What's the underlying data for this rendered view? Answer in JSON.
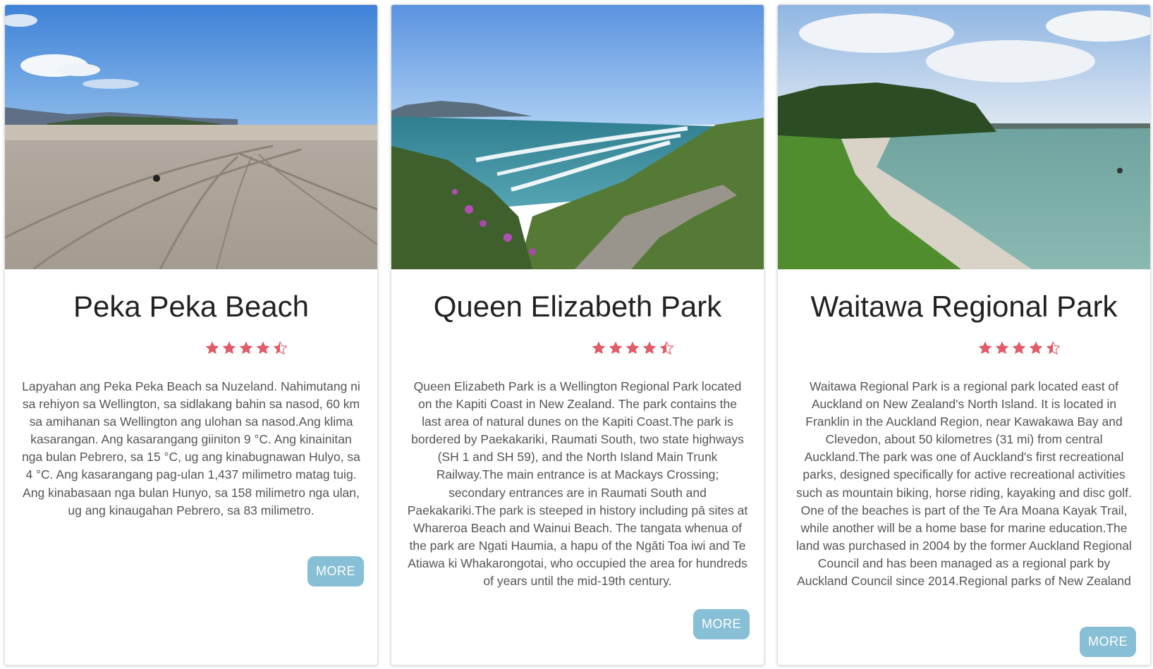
{
  "colors": {
    "star": "#e05c68",
    "more_button": "#87bfd6",
    "title": "#222222",
    "description": "#555555"
  },
  "cards": [
    {
      "title": "Peka Peka Beach",
      "rating": 4.5,
      "description": "Lapyahan ang Peka Peka Beach sa Nuzeland. Nahimutang ni sa rehiyon sa Wellington, sa sidlakang bahin sa nasod, 60 km sa amihanan sa Wellington ang ulohan sa nasod.Ang klima kasarangan. Ang kasarangang giiniton 9 °C. Ang kinainitan nga bulan Pebrero, sa 15 °C, ug ang kinabugnawan Hulyo, sa 4 °C. Ang kasarangang pag-ulan 1,437 milimetro matag tuig. Ang kinabasaan nga bulan Hunyo, sa 158 milimetro nga ulan, ug ang kinaugahan Pebrero, sa 83 milimetro.",
      "more_label": "MORE"
    },
    {
      "title": "Queen Elizabeth Park",
      "rating": 4.5,
      "description": "Queen Elizabeth Park is a Wellington Regional Park located on the Kapiti Coast in New Zealand. The park contains the last area of natural dunes on the Kapiti Coast.The park is bordered by Paekakariki, Raumati South, two state highways (SH 1 and SH 59), and the North Island Main Trunk Railway.The main entrance is at Mackays Crossing; secondary entrances are in Raumati South and Paekakariki.The park is steeped in history including pā sites at Whareroa Beach and Wainui Beach. The tangata whenua of the park are Ngati Haumia, a hapu of the Ngāti Toa iwi and Te Atiawa ki Whakarongotai, who occupied the area for hundreds of years until the mid-19th century.",
      "more_label": "MORE"
    },
    {
      "title": "Waitawa Regional Park",
      "rating": 4.5,
      "description": "Waitawa Regional Park is a regional park located east of Auckland on New Zealand's North Island. It is located in Franklin in the Auckland Region, near Kawakawa Bay and Clevedon, about 50 kilometres (31 mi) from central Auckland.The park was one of Auckland's first recreational parks, designed specifically for active recreational activities such as mountain biking, horse riding, kayaking and disc golf. One of the beaches is part of the Te Ara Moana Kayak Trail, while another will be a home base for marine education.The land was purchased in 2004 by the former Auckland Regional Council and has been managed as a regional park by Auckland Council since 2014.Regional parks of New Zealand",
      "more_label": "MORE"
    }
  ]
}
